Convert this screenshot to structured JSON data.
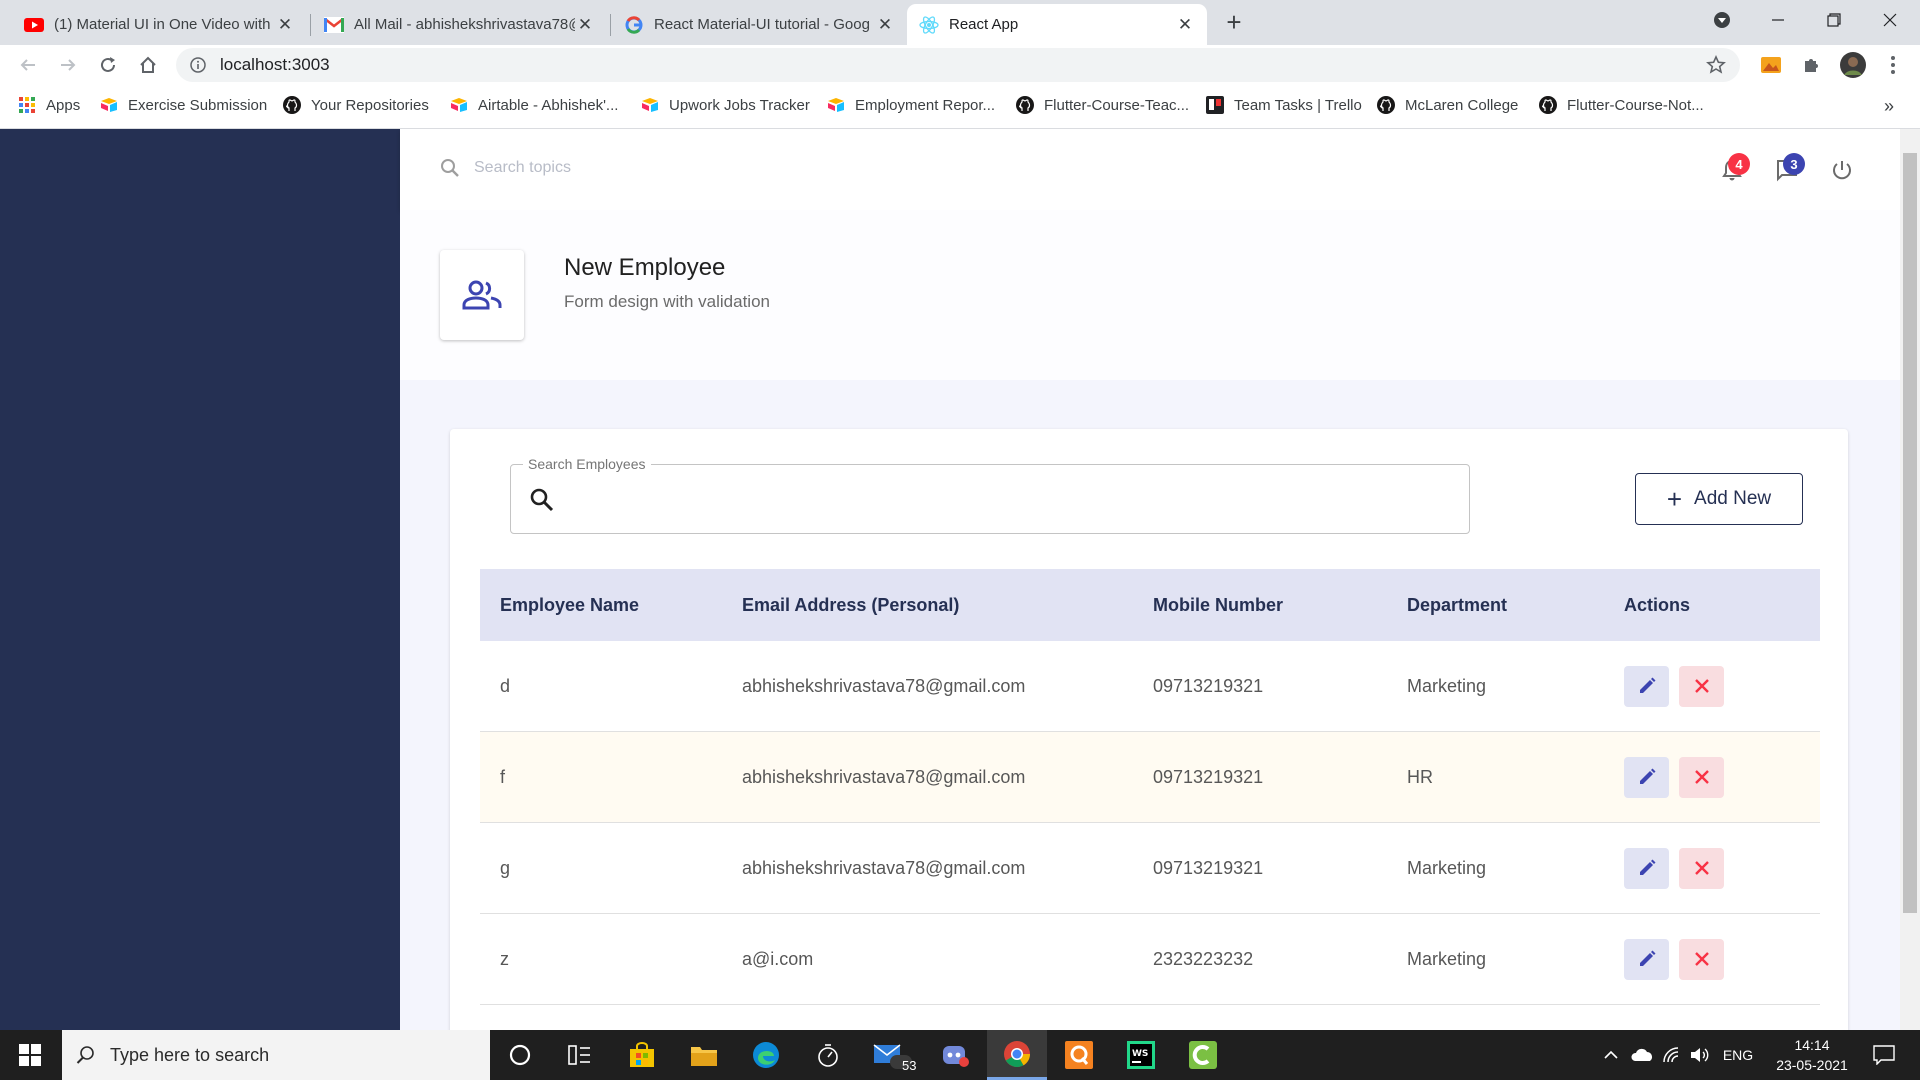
{
  "browser": {
    "tabs": [
      {
        "title": "(1) Material UI in One Video with",
        "icon": "youtube-icon"
      },
      {
        "title": "All Mail - abhishekshrivastava78@",
        "icon": "gmail-icon"
      },
      {
        "title": "React Material-UI tutorial - Goog",
        "icon": "google-icon"
      },
      {
        "title": "React App",
        "icon": "react-icon",
        "active": true
      }
    ],
    "url": "localhost:3003",
    "bookmarks": [
      {
        "label": "Apps",
        "icon": "apps-grid-icon"
      },
      {
        "label": "Exercise Submission",
        "icon": "airtable-icon"
      },
      {
        "label": "Your Repositories",
        "icon": "github-icon"
      },
      {
        "label": "Airtable - Abhishek'...",
        "icon": "airtable-icon"
      },
      {
        "label": "Upwork Jobs Tracker",
        "icon": "airtable-icon"
      },
      {
        "label": "Employment Repor...",
        "icon": "airtable-icon"
      },
      {
        "label": "Flutter-Course-Teac...",
        "icon": "github-icon"
      },
      {
        "label": "Team Tasks | Trello",
        "icon": "trello-icon"
      },
      {
        "label": "McLaren College",
        "icon": "github-icon"
      },
      {
        "label": "Flutter-Course-Not...",
        "icon": "github-icon"
      }
    ],
    "more_bookmarks": "»"
  },
  "app": {
    "search_placeholder": "Search topics",
    "notifications_count": "4",
    "messages_count": "3",
    "page_header": {
      "title": "New Employee",
      "subtitle": "Form design with validation",
      "icon": "people-outline-icon"
    },
    "employee_search": {
      "label": "Search Employees",
      "value": ""
    },
    "add_new_label": "Add New",
    "table": {
      "headers": [
        "Employee Name",
        "Email Address (Personal)",
        "Mobile Number",
        "Department",
        "Actions"
      ],
      "rows": [
        {
          "name": "d",
          "email": "abhishekshrivastava78@gmail.com",
          "mobile": "09713219321",
          "department": "Marketing"
        },
        {
          "name": "f",
          "email": "abhishekshrivastava78@gmail.com",
          "mobile": "09713219321",
          "department": "HR"
        },
        {
          "name": "g",
          "email": "abhishekshrivastava78@gmail.com",
          "mobile": "09713219321",
          "department": "Marketing"
        },
        {
          "name": "z",
          "email": "a@i.com",
          "mobile": "2323223232",
          "department": "Marketing"
        }
      ]
    }
  },
  "taskbar": {
    "search_placeholder": "Type here to search",
    "mail_badge": "53",
    "language": "ENG",
    "time": "14:14",
    "date": "23-05-2021"
  },
  "colors": {
    "sidebar": "#253053",
    "primary": "#253053",
    "secondary_red": "#f83245",
    "badge_blue": "#3c44b1",
    "table_header": "#e1e3f3",
    "page_background": "#f4f5fd"
  }
}
